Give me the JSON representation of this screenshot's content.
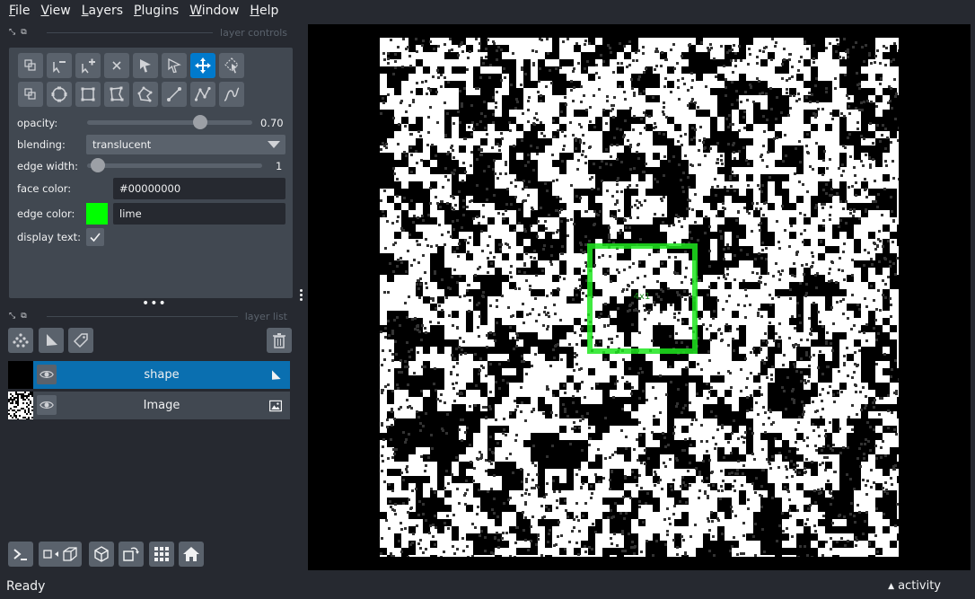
{
  "menubar": {
    "items": [
      {
        "mnemonic": "F",
        "rest": "ile"
      },
      {
        "mnemonic": "V",
        "rest": "iew"
      },
      {
        "mnemonic": "L",
        "rest": "ayers"
      },
      {
        "mnemonic": "P",
        "rest": "lugins"
      },
      {
        "mnemonic": "W",
        "rest": "indow"
      },
      {
        "mnemonic": "H",
        "rest": "elp"
      }
    ]
  },
  "layer_controls": {
    "title": "layer controls",
    "tool_icons_row1": [
      "shape-select-icon",
      "delete-vertex-icon",
      "add-vertex-icon",
      "delete-shape-icon",
      "select-vertex-icon",
      "direct-select-icon",
      "pan-zoom-icon",
      "transform-icon"
    ],
    "tool_icons_row2": [
      "move-back-icon",
      "ellipse-icon",
      "rectangle-icon",
      "polygon-icon",
      "polygon-lasso-icon",
      "line-icon",
      "path-icon",
      "polyline-icon"
    ],
    "active_tool": "pan-zoom-icon",
    "opacity": {
      "label": "opacity:",
      "value": "0.70",
      "fraction": 0.7
    },
    "blending": {
      "label": "blending:",
      "value": "translucent"
    },
    "edge_width": {
      "label": "edge width:",
      "value": "1",
      "fraction": 0.03
    },
    "face_color": {
      "label": "face color:",
      "value": "#00000000"
    },
    "edge_color": {
      "label": "edge color:",
      "value": "lime",
      "swatch": "#00ff00"
    },
    "display_text": {
      "label": "display text:",
      "checked": true
    }
  },
  "layer_list": {
    "title": "layer list",
    "layers": [
      {
        "name": "shape",
        "selected": true,
        "type_icon": "shapes-layer-icon"
      },
      {
        "name": "Image",
        "selected": false,
        "type_icon": "image-layer-icon"
      }
    ]
  },
  "canvas": {
    "annotation_text": "4x1",
    "box_color": "#1ee61e"
  },
  "status": {
    "text": "Ready",
    "activity": "activity"
  },
  "colors": {
    "background": "#262930",
    "panel": "#414851",
    "button": "#5a626c",
    "accent": "#007acc",
    "selected_row": "#0a6fb0"
  }
}
